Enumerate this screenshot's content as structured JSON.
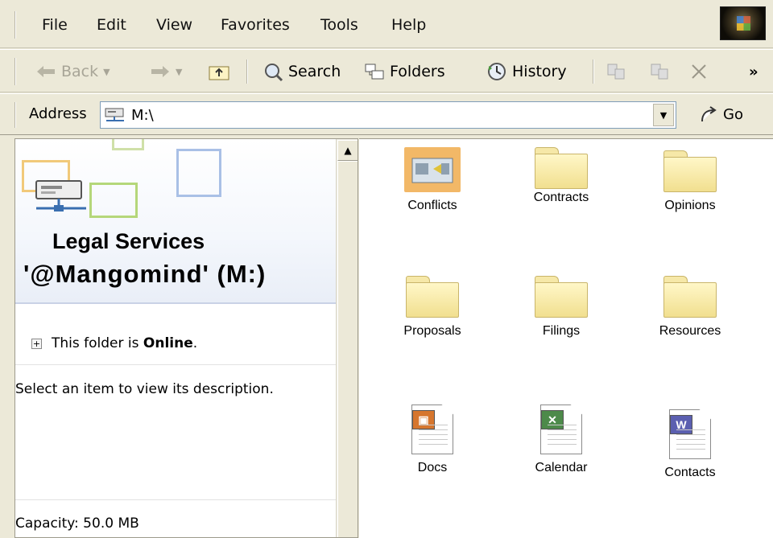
{
  "menu": {
    "items": [
      "File",
      "Edit",
      "View",
      "Favorites",
      "Tools",
      "Help"
    ]
  },
  "toolbar": {
    "back": "Back",
    "search": "Search",
    "folders": "Folders",
    "history": "History",
    "more": "»"
  },
  "address": {
    "label": "Address",
    "value": "M:\\",
    "go": "Go"
  },
  "left": {
    "title_line1": "Legal Services",
    "title_line2": "'@Mangomind' (M:)",
    "status_prefix": "This folder is ",
    "status_value": "Online",
    "status_suffix": ".",
    "description": "Select an item to view its description.",
    "capacity": "Capacity: 50.0 MB"
  },
  "items": [
    {
      "label": "Conflicts",
      "icon": "special-folder-icon"
    },
    {
      "label": "Contracts",
      "icon": "folder-icon"
    },
    {
      "label": "Opinions",
      "icon": "folder-icon"
    },
    {
      "label": "Proposals",
      "icon": "folder-icon"
    },
    {
      "label": "Filings",
      "icon": "folder-icon"
    },
    {
      "label": "Resources",
      "icon": "folder-icon"
    },
    {
      "label": "Docs",
      "icon": "powerpoint-file-icon"
    },
    {
      "label": "Calendar",
      "icon": "excel-file-icon"
    },
    {
      "label": "Contacts",
      "icon": "word-file-icon"
    }
  ],
  "colors": {
    "chrome": "#ece9d8",
    "folder": "#f1df8f",
    "pane_border": "#9d9a8c"
  }
}
